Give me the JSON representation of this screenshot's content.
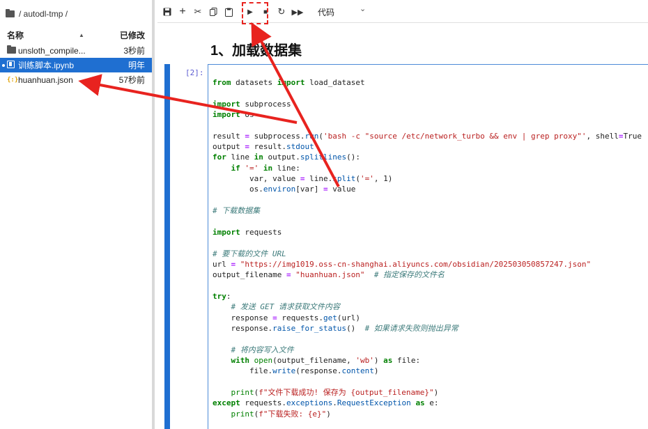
{
  "sidebar": {
    "breadcrumb": "/ autodl-tmp /",
    "columns": {
      "name": "名称",
      "modified": "已修改"
    },
    "files": [
      {
        "name": "unsloth_compile...",
        "modified": "3秒前",
        "icon": "folder-icon"
      },
      {
        "name": "训练脚本.ipynb",
        "modified": "明年",
        "icon": "notebook-icon",
        "selected": true,
        "running": true
      },
      {
        "name": "huanhuan.json",
        "modified": "57秒前",
        "icon": "json-icon"
      }
    ]
  },
  "toolbar": {
    "buttons": [
      {
        "name": "save-icon",
        "glyph": "🖫"
      },
      {
        "name": "add-cell-icon",
        "glyph": "+"
      },
      {
        "name": "cut-icon",
        "glyph": "✂"
      },
      {
        "name": "copy-icon",
        "glyph": "⎘"
      },
      {
        "name": "paste-icon",
        "glyph": "📋"
      },
      {
        "name": "run-icon",
        "glyph": "▶"
      },
      {
        "name": "stop-icon",
        "glyph": "■"
      },
      {
        "name": "restart-icon",
        "glyph": "↻"
      },
      {
        "name": "run-all-icon",
        "glyph": "⏩"
      }
    ],
    "cell_type": "代码",
    "cell_type_chevron": "⌄"
  },
  "notebook": {
    "heading": "1、加载数据集",
    "prompt": "[2]:",
    "code_lines": [
      "from datasets import load_dataset",
      "",
      "import subprocess",
      "import os",
      "",
      "result = subprocess.run('bash -c \"source /etc/network_turbo && env | grep proxy\"', shell=True",
      "output = result.stdout",
      "for line in output.splitlines():",
      "    if '=' in line:",
      "        var, value = line.split('=', 1)",
      "        os.environ[var] = value",
      "",
      "# 下载数据集",
      "",
      "import requests",
      "",
      "# 要下载的文件 URL",
      "url = \"https://img1019.oss-cn-shanghai.aliyuncs.com/obsidian/202503050857247.json\"",
      "output_filename = \"huanhuan.json\"  # 指定保存的文件名",
      "",
      "try:",
      "    # 发送 GET 请求获取文件内容",
      "    response = requests.get(url)",
      "    response.raise_for_status()  # 如果请求失败则抛出异常",
      "",
      "    # 将内容写入文件",
      "    with open(output_filename, 'wb') as file:",
      "        file.write(response.content)",
      "",
      "    print(f\"文件下载成功! 保存为 {output_filename}\")",
      "except requests.exceptions.RequestException as e:",
      "    print(f\"下载失败: {e}\")"
    ]
  },
  "annotation_color": "#e8231f",
  "accent_color": "#1f6fd1"
}
